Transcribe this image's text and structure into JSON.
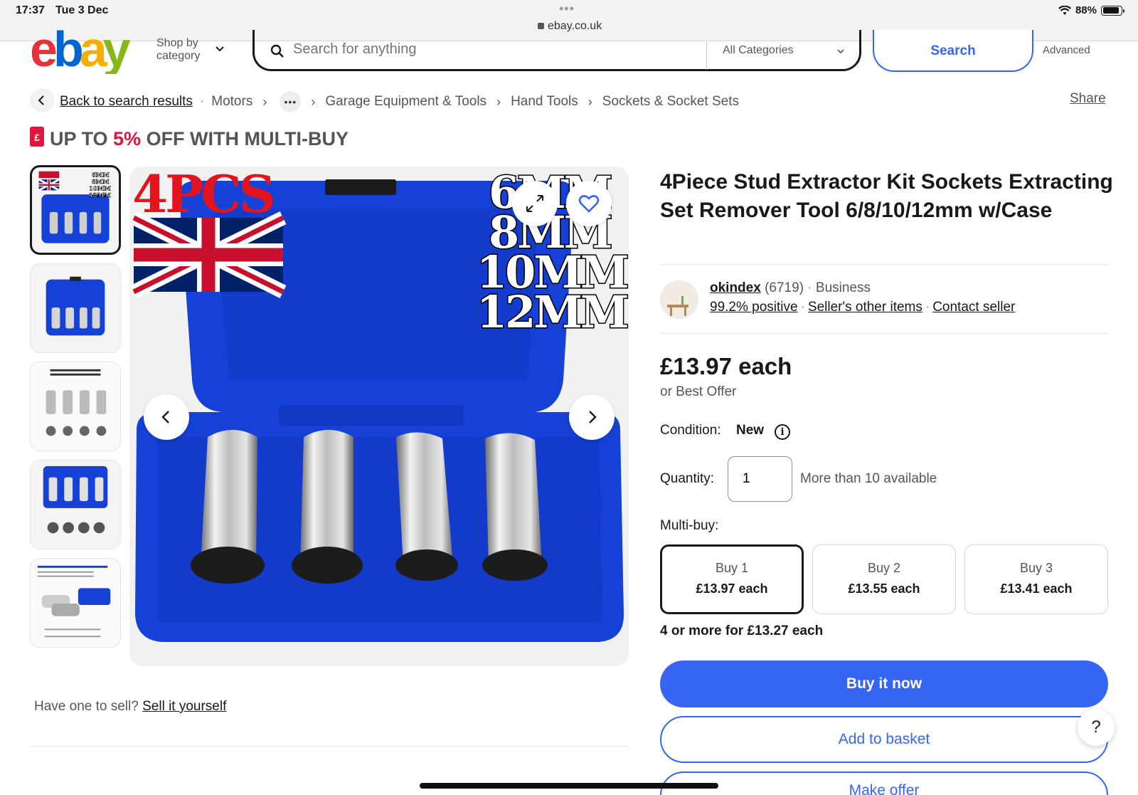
{
  "status_bar": {
    "time": "17:37",
    "date": "Tue 3 Dec",
    "url": "ebay.co.uk",
    "battery": "88%",
    "battery_level": 0.88
  },
  "header": {
    "logo_letters": [
      "e",
      "b",
      "a",
      "y"
    ],
    "logo_colors": [
      "#e53238",
      "#0064d2",
      "#f5af02",
      "#86b817"
    ],
    "shop_by_line1": "Shop by",
    "shop_by_line2": "category",
    "search_placeholder": "Search for anything",
    "category": "All Categories",
    "search_button": "Search",
    "advanced": "Advanced"
  },
  "breadcrumb": {
    "back": "Back to search results",
    "items": [
      "Motors",
      "Garage Equipment & Tools",
      "Hand Tools",
      "Sockets & Socket Sets"
    ],
    "more": "•••",
    "share": "Share"
  },
  "promo": {
    "prefix": "UP TO ",
    "highlight": "5%",
    "suffix": " OFF WITH MULTI-BUY",
    "icon": "£"
  },
  "gallery": {
    "image_text": {
      "pcs": "4PCS",
      "sizes": [
        "6MM",
        "8MM",
        "10MM",
        "12MM"
      ]
    },
    "thumb_count": 5
  },
  "have_one": {
    "prefix": "Have one to sell?",
    "link": "Sell it yourself"
  },
  "product": {
    "title": "4Piece Stud Extractor Kit Sockets Extracting Set Remover Tool 6/8/10/12mm w/Case",
    "seller": {
      "name": "okindex",
      "feedback_count": "(6719)",
      "type": "Business",
      "positive": "99.2% positive",
      "other_items": "Seller's other items",
      "contact": "Contact seller"
    },
    "price": "£13.97 each",
    "best_offer": "or Best Offer",
    "condition_label": "Condition:",
    "condition_value": "New",
    "quantity_label": "Quantity:",
    "quantity_value": "1",
    "availability": "More than 10 available",
    "multibuy_label": "Multi-buy:",
    "multibuy": [
      {
        "label": "Buy 1",
        "price": "£13.97 each"
      },
      {
        "label": "Buy 2",
        "price": "£13.55 each"
      },
      {
        "label": "Buy 3",
        "price": "£13.41 each"
      }
    ],
    "multibuy_more": "4 or more for £13.27 each",
    "buy_now": "Buy it now",
    "add_to_basket": "Add to basket",
    "make_offer": "Make offer"
  },
  "help": "?",
  "colors": {
    "accent_blue": "#3665f3",
    "promo_red": "#e0163f",
    "case_blue": "#1541d6"
  }
}
